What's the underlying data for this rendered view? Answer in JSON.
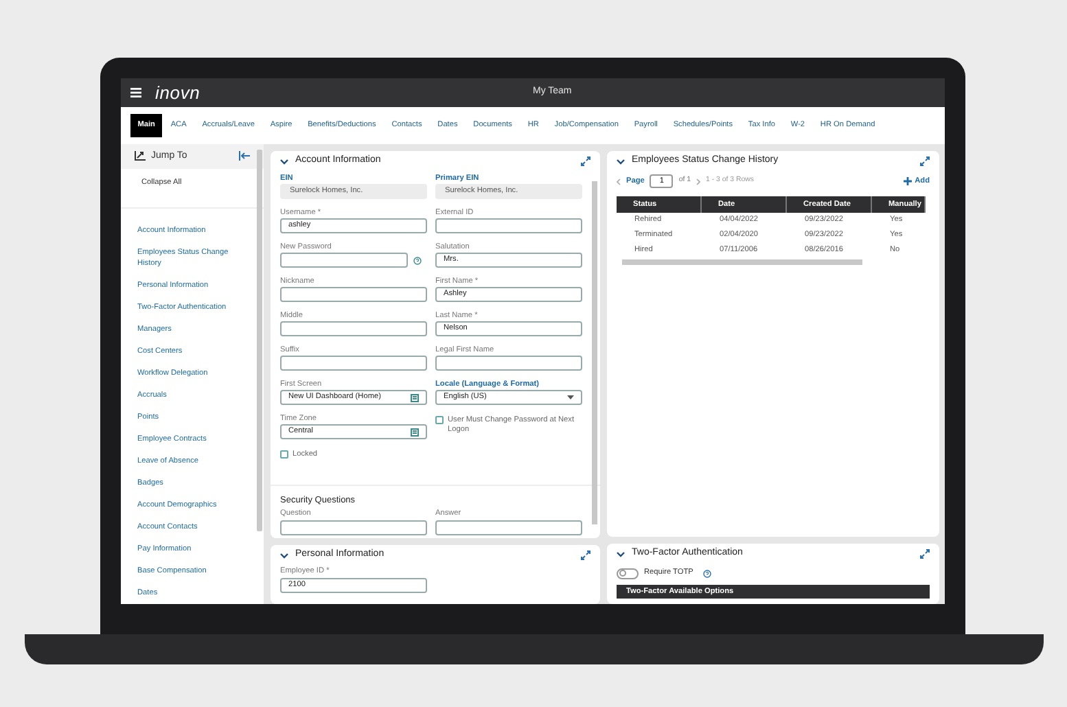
{
  "header": {
    "logo": "inovn",
    "title": "My Team"
  },
  "tabs": [
    {
      "label": "Main",
      "selected": true
    },
    {
      "label": "ACA",
      "selected": false
    },
    {
      "label": "Accruals/Leave",
      "selected": false
    },
    {
      "label": "Aspire",
      "selected": false
    },
    {
      "label": "Benefits/Deductions",
      "selected": false
    },
    {
      "label": "Contacts",
      "selected": false
    },
    {
      "label": "Dates",
      "selected": false
    },
    {
      "label": "Documents",
      "selected": false
    },
    {
      "label": "HR",
      "selected": false
    },
    {
      "label": "Job/Compensation",
      "selected": false
    },
    {
      "label": "Payroll",
      "selected": false
    },
    {
      "label": "Schedules/Points",
      "selected": false
    },
    {
      "label": "Tax Info",
      "selected": false
    },
    {
      "label": "W-2",
      "selected": false
    },
    {
      "label": "HR On Demand",
      "selected": false
    }
  ],
  "sidebar": {
    "title": "Jump To",
    "collapse": "Collapse All",
    "items": [
      "Account Information",
      "Employees Status Change History",
      "Personal Information",
      "Two-Factor Authentication",
      "Managers",
      "Cost Centers",
      "Workflow Delegation",
      "Accruals",
      "Points",
      "Employee Contracts",
      "Leave of Absence",
      "Badges",
      "Account Demographics",
      "Account Contacts",
      "Pay Information",
      "Base Compensation",
      "Dates"
    ]
  },
  "account_information": {
    "title": "Account Information",
    "fields": [
      {
        "kind": "readonly",
        "label": "EIN",
        "highlighted": true,
        "value": "Surelock Homes, Inc."
      },
      {
        "kind": "readonly",
        "label": "Primary EIN",
        "highlighted": true,
        "value": "Surelock Homes, Inc."
      },
      {
        "kind": "text",
        "label": "Username *",
        "highlighted": false,
        "value": "ashley"
      },
      {
        "kind": "text",
        "label": "External ID",
        "highlighted": false
      },
      {
        "kind": "password",
        "label": "New Password",
        "highlighted": false
      },
      {
        "kind": "text",
        "label": "Salutation",
        "highlighted": false,
        "value": "Mrs."
      },
      {
        "kind": "text",
        "label": "Nickname",
        "highlighted": false
      },
      {
        "kind": "text",
        "label": "First Name *",
        "highlighted": false,
        "value": "Ashley"
      },
      {
        "kind": "text",
        "label": "Middle",
        "highlighted": false
      },
      {
        "kind": "text",
        "label": "Last Name *",
        "highlighted": false,
        "value": "Nelson"
      },
      {
        "kind": "text",
        "label": "Suffix",
        "highlighted": false
      },
      {
        "kind": "text",
        "label": "Legal First Name",
        "highlighted": false
      },
      {
        "kind": "lookup",
        "label": "First Screen",
        "highlighted": false,
        "value": "New UI Dashboard (Home)"
      },
      {
        "kind": "select",
        "label": "Locale (Language & Format)",
        "highlighted": true,
        "value": "English (US)"
      },
      {
        "kind": "lookup",
        "label": "Time Zone",
        "highlighted": false,
        "value": "Central"
      },
      {
        "kind": "checkbox",
        "label": "User Must Change Password at Next Logon",
        "checked": false
      },
      {
        "kind": "checkbox",
        "label": "Locked",
        "checked": false
      }
    ],
    "security": {
      "title": "Security Questions",
      "fields": [
        {
          "label": "Question"
        },
        {
          "label": "Answer"
        }
      ]
    }
  },
  "personal_information": {
    "title": "Personal Information",
    "fields": [
      {
        "label": "Employee ID *",
        "value": "2100"
      }
    ]
  },
  "status_history": {
    "title": "Employees Status Change History",
    "pager": {
      "page_label": "Page",
      "page": "1",
      "of": "of 1",
      "rows": "1 - 3 of 3 Rows"
    },
    "add": "Add",
    "columns": [
      "Status",
      "Date",
      "Created Date",
      "Manually"
    ],
    "rows": [
      [
        "Rehired",
        "04/04/2022",
        "09/23/2022",
        "Yes"
      ],
      [
        "Terminated",
        "02/04/2020",
        "09/23/2022",
        "Yes"
      ],
      [
        "Hired",
        "07/11/2006",
        "08/26/2016",
        "No"
      ]
    ]
  },
  "two_factor": {
    "title": "Two-Factor Authentication",
    "toggle": {
      "label": "Require TOTP",
      "on": false
    },
    "options_header": "Two-Factor Available Options"
  }
}
